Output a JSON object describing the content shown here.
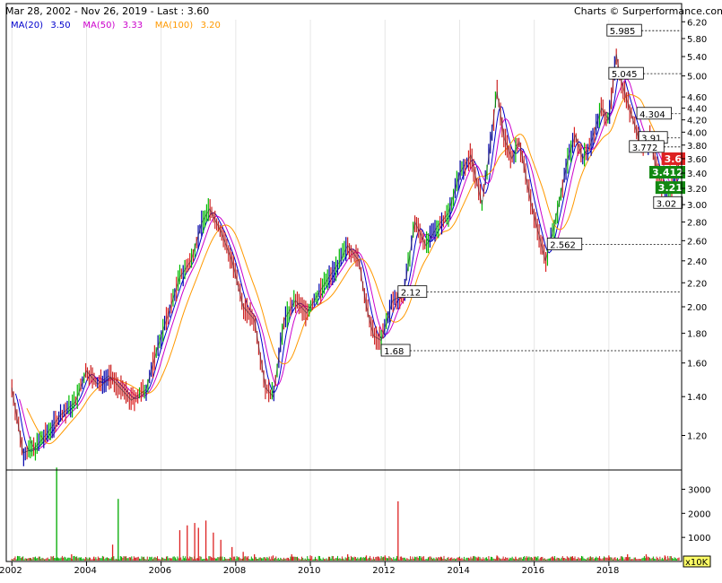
{
  "header": {
    "range": "Mar 28, 2002 - Nov 26, 2019 - Last : 3.60",
    "credit": "Charts © Surperformance.com"
  },
  "legend": [
    {
      "label": "MA(20)",
      "value": "3.50",
      "color": "#0000cc"
    },
    {
      "label": "MA(50)",
      "value": "3.33",
      "color": "#cc00cc"
    },
    {
      "label": "MA(100)",
      "value": "3.20",
      "color": "#ff9900"
    }
  ],
  "chart_data": {
    "type": "line",
    "scale": "log",
    "ylim": [
      1.05,
      6.25
    ],
    "xlim": [
      2001.85,
      2019.95
    ],
    "y_ticks": [
      "1.20",
      "1.40",
      "1.60",
      "1.80",
      "2.00",
      "2.20",
      "2.40",
      "2.60",
      "2.80",
      "3.00",
      "3.20",
      "3.40",
      "3.60",
      "3.80",
      "4.00",
      "4.20",
      "4.40",
      "4.60",
      "5.00",
      "5.40",
      "5.80",
      "6.20"
    ],
    "x_ticks": [
      "2002",
      "2004",
      "2006",
      "2008",
      "2010",
      "2012",
      "2014",
      "2016",
      "2018"
    ],
    "price_series": {
      "name": "Price",
      "points": [
        [
          2002.0,
          1.45
        ],
        [
          2002.3,
          1.12
        ],
        [
          2002.6,
          1.14
        ],
        [
          2002.9,
          1.2
        ],
        [
          2003.3,
          1.3
        ],
        [
          2003.7,
          1.37
        ],
        [
          2004.0,
          1.55
        ],
        [
          2004.3,
          1.47
        ],
        [
          2004.6,
          1.52
        ],
        [
          2004.9,
          1.45
        ],
        [
          2005.2,
          1.38
        ],
        [
          2005.6,
          1.44
        ],
        [
          2005.9,
          1.7
        ],
        [
          2006.2,
          1.95
        ],
        [
          2006.5,
          2.25
        ],
        [
          2006.8,
          2.4
        ],
        [
          2007.1,
          2.8
        ],
        [
          2007.3,
          2.95
        ],
        [
          2007.6,
          2.7
        ],
        [
          2007.9,
          2.4
        ],
        [
          2008.2,
          2.0
        ],
        [
          2008.5,
          1.9
        ],
        [
          2008.8,
          1.45
        ],
        [
          2009.0,
          1.4
        ],
        [
          2009.3,
          1.9
        ],
        [
          2009.6,
          2.05
        ],
        [
          2009.9,
          1.95
        ],
        [
          2010.2,
          2.1
        ],
        [
          2010.5,
          2.25
        ],
        [
          2010.8,
          2.4
        ],
        [
          2011.0,
          2.55
        ],
        [
          2011.3,
          2.4
        ],
        [
          2011.5,
          2.0
        ],
        [
          2011.7,
          1.78
        ],
        [
          2011.9,
          1.75
        ],
        [
          2012.2,
          2.05
        ],
        [
          2012.5,
          2.1
        ],
        [
          2012.8,
          2.8
        ],
        [
          2013.1,
          2.55
        ],
        [
          2013.4,
          2.75
        ],
        [
          2013.7,
          2.9
        ],
        [
          2014.0,
          3.4
        ],
        [
          2014.3,
          3.65
        ],
        [
          2014.6,
          3.0
        ],
        [
          2014.8,
          3.7
        ],
        [
          2015.0,
          4.7
        ],
        [
          2015.2,
          3.9
        ],
        [
          2015.4,
          3.6
        ],
        [
          2015.6,
          3.85
        ],
        [
          2015.9,
          3.05
        ],
        [
          2016.1,
          2.7
        ],
        [
          2016.3,
          2.4
        ],
        [
          2016.5,
          2.7
        ],
        [
          2016.7,
          3.1
        ],
        [
          2016.9,
          3.6
        ],
        [
          2017.1,
          3.95
        ],
        [
          2017.3,
          3.6
        ],
        [
          2017.5,
          3.8
        ],
        [
          2017.8,
          4.4
        ],
        [
          2018.0,
          4.2
        ],
        [
          2018.2,
          5.45
        ],
        [
          2018.3,
          5.0
        ],
        [
          2018.5,
          4.5
        ],
        [
          2018.7,
          4.1
        ],
        [
          2018.9,
          3.7
        ],
        [
          2019.1,
          3.9
        ],
        [
          2019.3,
          3.4
        ],
        [
          2019.5,
          3.15
        ],
        [
          2019.7,
          3.2
        ],
        [
          2019.9,
          3.6
        ]
      ]
    },
    "ma_series": [
      {
        "name": "MA(20)",
        "color": "#0000cc",
        "lag": 0.1
      },
      {
        "name": "MA(50)",
        "color": "#cc00cc",
        "lag": 0.2
      },
      {
        "name": "MA(100)",
        "color": "#ff9900",
        "lag": 0.4
      }
    ],
    "annotations": [
      {
        "label": "5.985",
        "x": 2017.95,
        "y": 5.985,
        "type": "high"
      },
      {
        "label": "5.045",
        "x": 2018.0,
        "y": 5.045,
        "type": "level"
      },
      {
        "label": "4.304",
        "x": 2018.75,
        "y": 4.304,
        "type": "level"
      },
      {
        "label": "3.91",
        "x": 2018.8,
        "y": 3.91,
        "type": "level"
      },
      {
        "label": "3.772",
        "x": 2018.55,
        "y": 3.772,
        "type": "level"
      },
      {
        "label": "3.02",
        "x": 2019.2,
        "y": 3.02,
        "type": "level"
      },
      {
        "label": "2.562",
        "x": 2016.35,
        "y": 2.562,
        "type": "level"
      },
      {
        "label": "2.12",
        "x": 2012.35,
        "y": 2.12,
        "type": "level"
      },
      {
        "label": "1.68",
        "x": 2011.9,
        "y": 1.68,
        "type": "level"
      }
    ],
    "price_tags": [
      {
        "label": "3.6",
        "y": 3.6,
        "color": "#dd2222"
      },
      {
        "label": "3.412",
        "y": 3.412,
        "color": "#118811"
      },
      {
        "label": "3.21",
        "y": 3.21,
        "color": "#118811"
      }
    ],
    "volume": {
      "unit": "x10K",
      "ylim": [
        0,
        3800
      ],
      "y_ticks": [
        "1000",
        "2000",
        "3000"
      ],
      "bars": [
        [
          2002.0,
          100
        ],
        [
          2002.5,
          150
        ],
        [
          2003.2,
          3900
        ],
        [
          2003.6,
          300
        ],
        [
          2004.2,
          200
        ],
        [
          2004.7,
          700
        ],
        [
          2004.85,
          2600
        ],
        [
          2005.3,
          150
        ],
        [
          2006.5,
          1300
        ],
        [
          2006.7,
          1500
        ],
        [
          2006.9,
          1600
        ],
        [
          2007.0,
          1400
        ],
        [
          2007.2,
          1700
        ],
        [
          2007.4,
          1200
        ],
        [
          2007.6,
          900
        ],
        [
          2007.9,
          600
        ],
        [
          2008.2,
          400
        ],
        [
          2008.5,
          300
        ],
        [
          2009.0,
          250
        ],
        [
          2009.5,
          300
        ],
        [
          2010.0,
          250
        ],
        [
          2010.5,
          200
        ],
        [
          2011.0,
          300
        ],
        [
          2011.5,
          250
        ],
        [
          2012.0,
          250
        ],
        [
          2012.35,
          2500
        ],
        [
          2013.0,
          200
        ],
        [
          2013.5,
          200
        ],
        [
          2014.0,
          150
        ],
        [
          2014.5,
          200
        ],
        [
          2015.0,
          250
        ],
        [
          2015.5,
          200
        ],
        [
          2016.0,
          200
        ],
        [
          2016.5,
          200
        ],
        [
          2017.0,
          200
        ],
        [
          2017.5,
          200
        ],
        [
          2018.0,
          250
        ],
        [
          2018.5,
          300
        ],
        [
          2019.0,
          300
        ],
        [
          2019.5,
          250
        ]
      ]
    }
  }
}
